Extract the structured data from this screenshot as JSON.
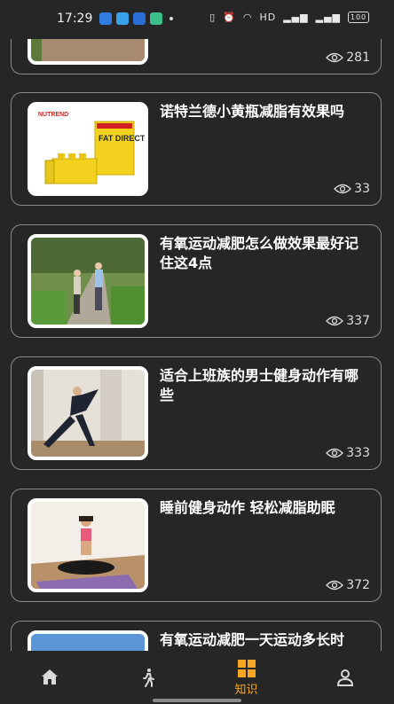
{
  "status_bar": {
    "time": "17:29",
    "network": "HD",
    "battery": "100"
  },
  "feed": {
    "items": [
      {
        "title": "",
        "views": "281"
      },
      {
        "title": "诺特兰德小黄瓶减脂有效果吗",
        "views": "33"
      },
      {
        "title": "有氧运动减肥怎么做效果最好记住这4点",
        "views": "337"
      },
      {
        "title": "适合上班族的男士健身动作有哪些",
        "views": "333"
      },
      {
        "title": "睡前健身动作 轻松减脂助眠",
        "views": "372"
      },
      {
        "title": "有氧运动减肥一天运动多长时",
        "views": ""
      }
    ],
    "product_brand": "NUTREND",
    "product_name": "FAT DIRECT"
  },
  "tabbar": {
    "tabs": [
      {
        "icon": "home-icon",
        "label": ""
      },
      {
        "icon": "walking-icon",
        "label": ""
      },
      {
        "icon": "knowledge-icon",
        "label": "知识",
        "active": true
      },
      {
        "icon": "profile-icon",
        "label": ""
      }
    ]
  },
  "colors": {
    "background": "#262626",
    "accent": "#f5a623",
    "card_border": "#8a8a8a"
  }
}
